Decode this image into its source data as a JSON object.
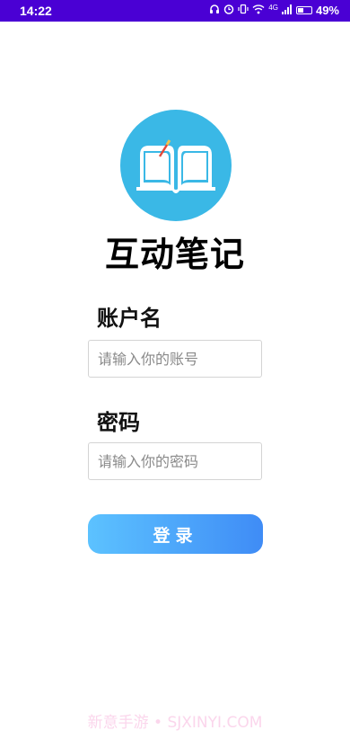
{
  "status_bar": {
    "time": "14:22",
    "network_label": "4G",
    "battery_percent": "49%",
    "battery_level": 0.49,
    "background_color": "#4a00d4"
  },
  "logo": {
    "icon": "open-book-icon",
    "circle_color": "#3ab8e6"
  },
  "app_title": "互动笔记",
  "account": {
    "label": "账户名",
    "placeholder": "请输入你的账号",
    "value": ""
  },
  "password": {
    "label": "密码",
    "placeholder": "请输入你的密码",
    "value": ""
  },
  "login_button": {
    "label": "登录",
    "gradient": [
      "#5cc2ff",
      "#3f8cf6"
    ]
  },
  "watermark": "新意手游 • SJXINYI.COM"
}
